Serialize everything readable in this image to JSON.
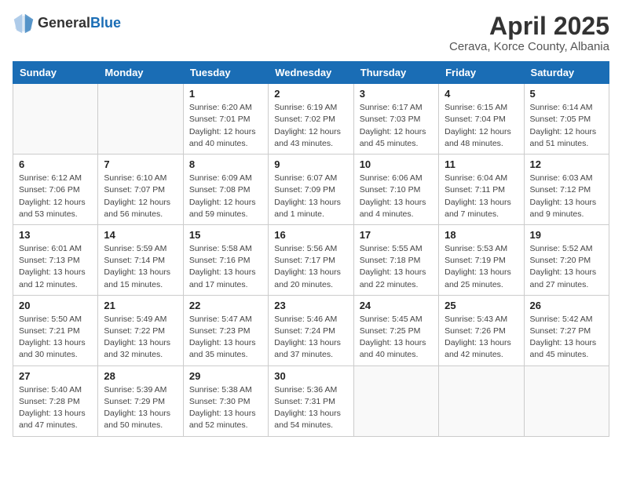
{
  "header": {
    "logo_general": "General",
    "logo_blue": "Blue",
    "title": "April 2025",
    "location": "Cerava, Korce County, Albania"
  },
  "calendar": {
    "days_of_week": [
      "Sunday",
      "Monday",
      "Tuesday",
      "Wednesday",
      "Thursday",
      "Friday",
      "Saturday"
    ],
    "weeks": [
      [
        {
          "day": "",
          "info": ""
        },
        {
          "day": "",
          "info": ""
        },
        {
          "day": "1",
          "info": "Sunrise: 6:20 AM\nSunset: 7:01 PM\nDaylight: 12 hours and 40 minutes."
        },
        {
          "day": "2",
          "info": "Sunrise: 6:19 AM\nSunset: 7:02 PM\nDaylight: 12 hours and 43 minutes."
        },
        {
          "day": "3",
          "info": "Sunrise: 6:17 AM\nSunset: 7:03 PM\nDaylight: 12 hours and 45 minutes."
        },
        {
          "day": "4",
          "info": "Sunrise: 6:15 AM\nSunset: 7:04 PM\nDaylight: 12 hours and 48 minutes."
        },
        {
          "day": "5",
          "info": "Sunrise: 6:14 AM\nSunset: 7:05 PM\nDaylight: 12 hours and 51 minutes."
        }
      ],
      [
        {
          "day": "6",
          "info": "Sunrise: 6:12 AM\nSunset: 7:06 PM\nDaylight: 12 hours and 53 minutes."
        },
        {
          "day": "7",
          "info": "Sunrise: 6:10 AM\nSunset: 7:07 PM\nDaylight: 12 hours and 56 minutes."
        },
        {
          "day": "8",
          "info": "Sunrise: 6:09 AM\nSunset: 7:08 PM\nDaylight: 12 hours and 59 minutes."
        },
        {
          "day": "9",
          "info": "Sunrise: 6:07 AM\nSunset: 7:09 PM\nDaylight: 13 hours and 1 minute."
        },
        {
          "day": "10",
          "info": "Sunrise: 6:06 AM\nSunset: 7:10 PM\nDaylight: 13 hours and 4 minutes."
        },
        {
          "day": "11",
          "info": "Sunrise: 6:04 AM\nSunset: 7:11 PM\nDaylight: 13 hours and 7 minutes."
        },
        {
          "day": "12",
          "info": "Sunrise: 6:03 AM\nSunset: 7:12 PM\nDaylight: 13 hours and 9 minutes."
        }
      ],
      [
        {
          "day": "13",
          "info": "Sunrise: 6:01 AM\nSunset: 7:13 PM\nDaylight: 13 hours and 12 minutes."
        },
        {
          "day": "14",
          "info": "Sunrise: 5:59 AM\nSunset: 7:14 PM\nDaylight: 13 hours and 15 minutes."
        },
        {
          "day": "15",
          "info": "Sunrise: 5:58 AM\nSunset: 7:16 PM\nDaylight: 13 hours and 17 minutes."
        },
        {
          "day": "16",
          "info": "Sunrise: 5:56 AM\nSunset: 7:17 PM\nDaylight: 13 hours and 20 minutes."
        },
        {
          "day": "17",
          "info": "Sunrise: 5:55 AM\nSunset: 7:18 PM\nDaylight: 13 hours and 22 minutes."
        },
        {
          "day": "18",
          "info": "Sunrise: 5:53 AM\nSunset: 7:19 PM\nDaylight: 13 hours and 25 minutes."
        },
        {
          "day": "19",
          "info": "Sunrise: 5:52 AM\nSunset: 7:20 PM\nDaylight: 13 hours and 27 minutes."
        }
      ],
      [
        {
          "day": "20",
          "info": "Sunrise: 5:50 AM\nSunset: 7:21 PM\nDaylight: 13 hours and 30 minutes."
        },
        {
          "day": "21",
          "info": "Sunrise: 5:49 AM\nSunset: 7:22 PM\nDaylight: 13 hours and 32 minutes."
        },
        {
          "day": "22",
          "info": "Sunrise: 5:47 AM\nSunset: 7:23 PM\nDaylight: 13 hours and 35 minutes."
        },
        {
          "day": "23",
          "info": "Sunrise: 5:46 AM\nSunset: 7:24 PM\nDaylight: 13 hours and 37 minutes."
        },
        {
          "day": "24",
          "info": "Sunrise: 5:45 AM\nSunset: 7:25 PM\nDaylight: 13 hours and 40 minutes."
        },
        {
          "day": "25",
          "info": "Sunrise: 5:43 AM\nSunset: 7:26 PM\nDaylight: 13 hours and 42 minutes."
        },
        {
          "day": "26",
          "info": "Sunrise: 5:42 AM\nSunset: 7:27 PM\nDaylight: 13 hours and 45 minutes."
        }
      ],
      [
        {
          "day": "27",
          "info": "Sunrise: 5:40 AM\nSunset: 7:28 PM\nDaylight: 13 hours and 47 minutes."
        },
        {
          "day": "28",
          "info": "Sunrise: 5:39 AM\nSunset: 7:29 PM\nDaylight: 13 hours and 50 minutes."
        },
        {
          "day": "29",
          "info": "Sunrise: 5:38 AM\nSunset: 7:30 PM\nDaylight: 13 hours and 52 minutes."
        },
        {
          "day": "30",
          "info": "Sunrise: 5:36 AM\nSunset: 7:31 PM\nDaylight: 13 hours and 54 minutes."
        },
        {
          "day": "",
          "info": ""
        },
        {
          "day": "",
          "info": ""
        },
        {
          "day": "",
          "info": ""
        }
      ]
    ]
  }
}
